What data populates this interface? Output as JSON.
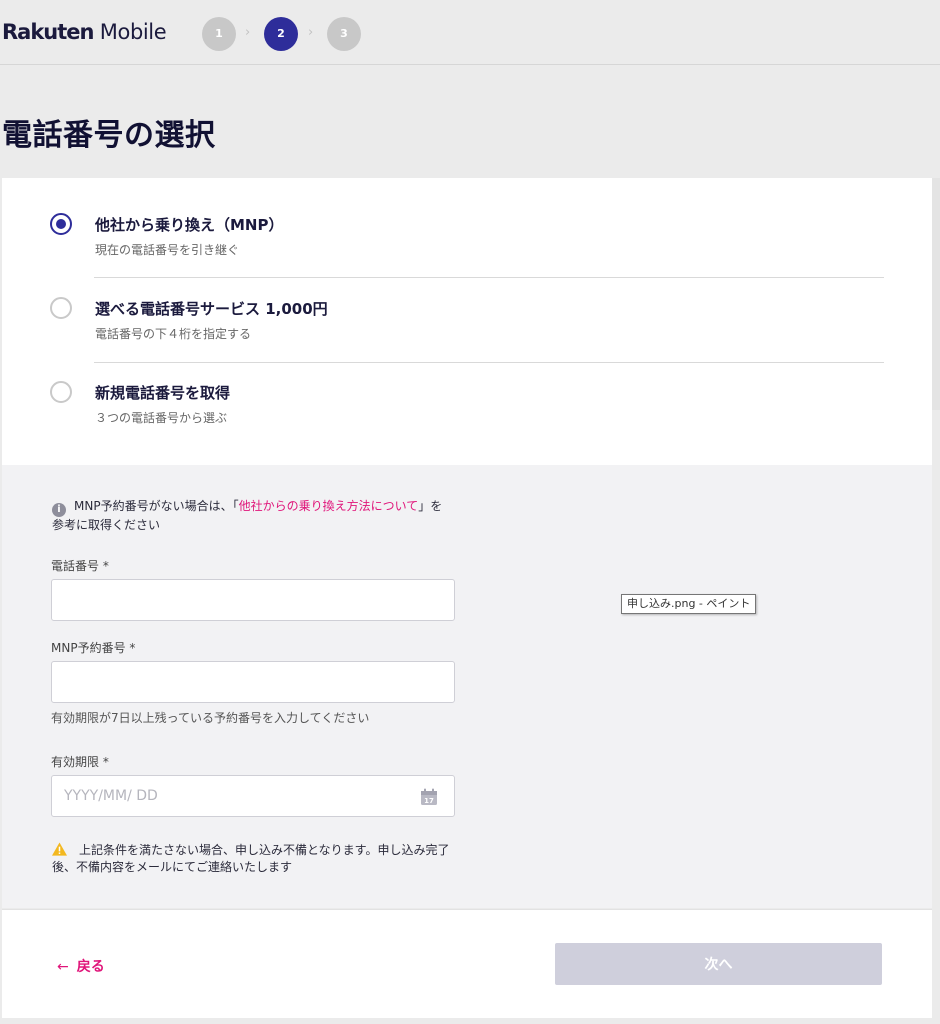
{
  "header": {
    "logo_brand": "Rakuten",
    "logo_sub": " Mobile",
    "steps": [
      "1",
      "2",
      "3"
    ],
    "active_step": "2"
  },
  "page_title": "電話番号の選択",
  "options": [
    {
      "title": "他社から乗り換え（MNP）",
      "description": "現在の電話番号を引き継ぐ",
      "selected": true
    },
    {
      "title": "選べる電話番号サービス 1,000円",
      "description": "電話番号の下４桁を指定する",
      "selected": false
    },
    {
      "title": "新規電話番号を取得",
      "description": "３つの電話番号から選ぶ",
      "selected": false
    }
  ],
  "form": {
    "info_prefix": "MNP予約番号がない場合は、「",
    "info_link": "他社からの乗り換え方法について",
    "info_suffix": "」を参考に取得ください",
    "phone_label": "電話番号 *",
    "phone_value": "",
    "mnp_label": "MNP予約番号 *",
    "mnp_value": "",
    "mnp_hint": "有効期限が7日以上残っている予約番号を入力してください",
    "expiry_label": "有効期限 *",
    "expiry_placeholder": "YYYY/MM/ DD",
    "calendar_day": "17",
    "warning": "上記条件を満たさない場合、申し込み不備となります。申し込み完了後、不備内容をメールにてご連絡いたします"
  },
  "footer": {
    "back_arrow": "←",
    "back_label": "戻る",
    "next_label": "次へ"
  },
  "tooltip": "申し込み.png - ペイント",
  "colors": {
    "accent": "#2e2d9a",
    "link": "#e0157a",
    "disabled_button": "#cfcfdc"
  }
}
